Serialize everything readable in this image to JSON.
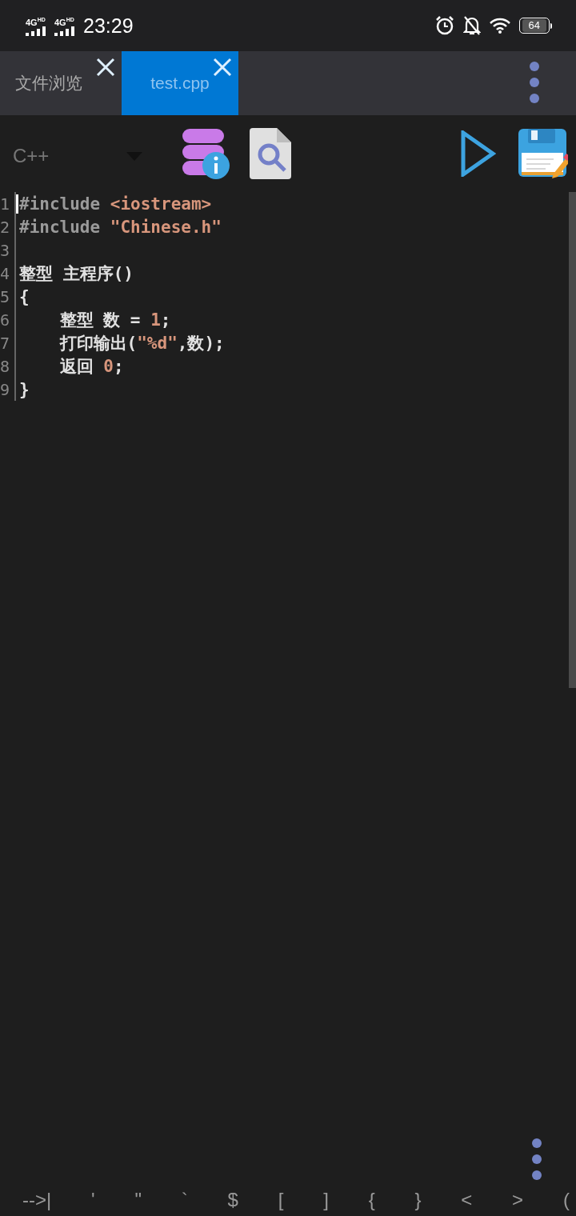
{
  "status_bar": {
    "network_1": "4G",
    "network_1_badge": "HD",
    "network_2": "4G",
    "network_2_badge": "HD",
    "time": "23:29",
    "battery": "64"
  },
  "tabs": [
    {
      "label": "文件浏览",
      "selected": false
    },
    {
      "label": "test.cpp",
      "selected": true
    }
  ],
  "toolbar": {
    "language": "C++"
  },
  "editor": {
    "lines": [
      {
        "number": "1",
        "segments": [
          {
            "kind": "directive",
            "text": "#include "
          },
          {
            "kind": "string",
            "text": "<iostream>"
          }
        ]
      },
      {
        "number": "2",
        "segments": [
          {
            "kind": "directive",
            "text": "#include "
          },
          {
            "kind": "string",
            "text": "\"Chinese.h\""
          }
        ]
      },
      {
        "number": "3"
      },
      {
        "number": "4",
        "segments": [
          {
            "kind": "plain",
            "text": "整型 主程序()"
          }
        ]
      },
      {
        "number": "5",
        "segments": [
          {
            "kind": "plain",
            "text": "{"
          }
        ]
      },
      {
        "number": "6",
        "segments": [
          {
            "kind": "plain",
            "text": "    整型 数 = "
          },
          {
            "kind": "number",
            "text": "1"
          },
          {
            "kind": "plain",
            "text": ";"
          }
        ]
      },
      {
        "number": "7",
        "segments": [
          {
            "kind": "plain",
            "text": "    打印输出("
          },
          {
            "kind": "string",
            "text": "\"%d\""
          },
          {
            "kind": "plain",
            "text": ",数);"
          }
        ]
      },
      {
        "number": "8",
        "segments": [
          {
            "kind": "plain",
            "text": "    返回 "
          },
          {
            "kind": "number",
            "text": "0"
          },
          {
            "kind": "plain",
            "text": ";"
          }
        ]
      },
      {
        "number": "9",
        "segments": [
          {
            "kind": "plain",
            "text": "}"
          }
        ]
      }
    ]
  },
  "symbol_keys": [
    "-->|",
    "'",
    "\"",
    "`",
    "$",
    "[",
    "]",
    "{",
    "}",
    "<",
    ">",
    "("
  ]
}
